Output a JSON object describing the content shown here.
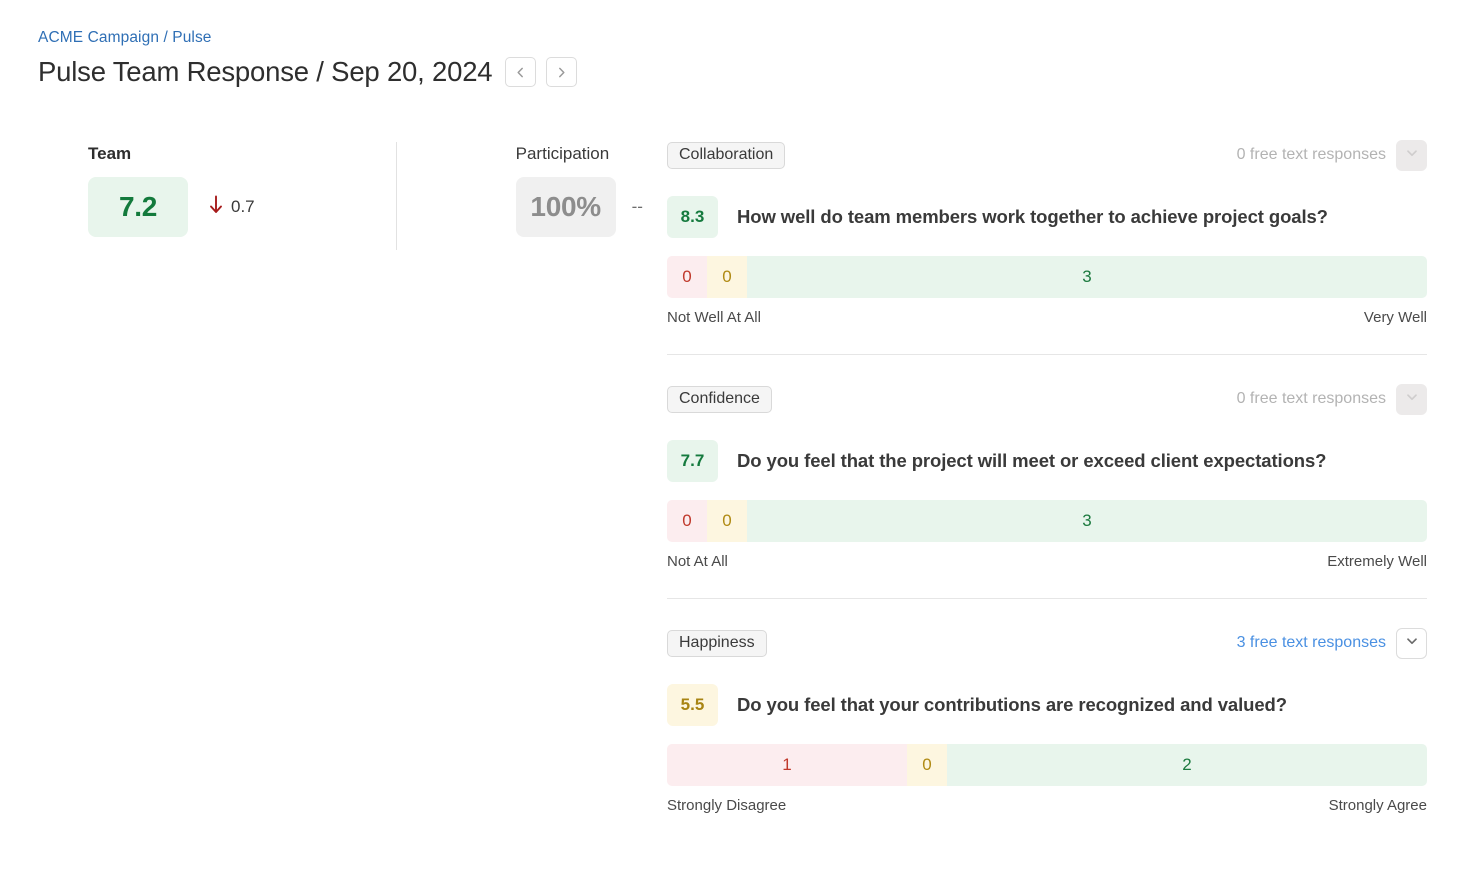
{
  "header": {
    "breadcrumb": "ACME Campaign / Pulse",
    "title": "Pulse Team Response / Sep 20, 2024",
    "prev_icon": "chevron-left-icon",
    "next_icon": "chevron-right-icon"
  },
  "metrics": [
    {
      "label": "Team",
      "value": "7.2",
      "chip_style": "green",
      "delta": "0.7",
      "delta_direction": "down",
      "delta_icon": "arrow-down-icon",
      "delta_color": "#a61b1b"
    },
    {
      "label": "Participation",
      "value": "100%",
      "chip_style": "grey",
      "delta": "--",
      "delta_direction": "none",
      "delta_icon": "",
      "delta_color": "#6d6d6d"
    }
  ],
  "questions": [
    {
      "tag": "Collaboration",
      "responses_label": "0 free text responses",
      "responses_active": false,
      "chevron_icon": "chevron-down-icon",
      "score": "8.3",
      "score_style": "green",
      "text": "How well do team members work together to achieve project goals?",
      "segments": [
        {
          "label": "0",
          "style": "neg",
          "percent": 5.26
        },
        {
          "label": "0",
          "style": "neu",
          "percent": 5.26
        },
        {
          "label": "3",
          "style": "pos",
          "percent": 89.48
        }
      ],
      "scale_low": "Not Well At All",
      "scale_high": "Very Well"
    },
    {
      "tag": "Confidence",
      "responses_label": "0 free text responses",
      "responses_active": false,
      "chevron_icon": "chevron-down-icon",
      "score": "7.7",
      "score_style": "green",
      "text": "Do you feel that the project will meet or exceed client expectations?",
      "segments": [
        {
          "label": "0",
          "style": "neg",
          "percent": 5.26
        },
        {
          "label": "0",
          "style": "neu",
          "percent": 5.26
        },
        {
          "label": "3",
          "style": "pos",
          "percent": 89.48
        }
      ],
      "scale_low": "Not At All",
      "scale_high": "Extremely Well"
    },
    {
      "tag": "Happiness",
      "responses_label": "3 free text responses",
      "responses_active": true,
      "chevron_icon": "chevron-down-icon",
      "score": "5.5",
      "score_style": "yellow",
      "text": "Do you feel that your contributions are recognized and valued?",
      "segments": [
        {
          "label": "1",
          "style": "neg",
          "percent": 31.58
        },
        {
          "label": "0",
          "style": "neu",
          "percent": 5.26
        },
        {
          "label": "2",
          "style": "pos",
          "percent": 63.16
        }
      ],
      "scale_low": "Strongly Disagree",
      "scale_high": "Strongly Agree"
    }
  ],
  "colors": {
    "link": "#2f6fb5",
    "responses_link": "#4a90e2",
    "positive": "#e8f5ec",
    "neutral": "#fdf6e0",
    "negative": "#fcedef",
    "positive_text": "#1c7a3f",
    "neutral_text": "#b08a13",
    "negative_text": "#c0392b"
  }
}
